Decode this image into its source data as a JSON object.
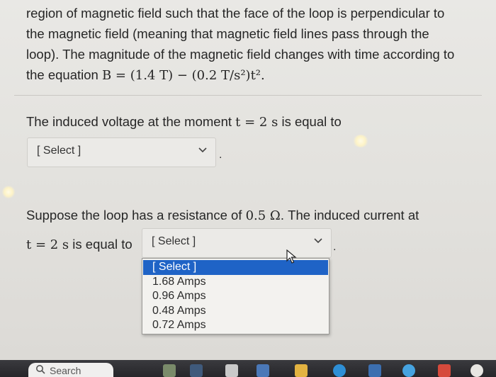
{
  "problem": {
    "line1": "region of magnetic field such that the face of the loop is perpendicular to",
    "line2": "the magnetic field (meaning that magnetic field lines pass through the",
    "line3": "loop). The magnitude of the magnetic field changes with time according to",
    "line4_prefix": "the equation ",
    "equation": "B = (1.4 T) − (0.2 T/s²)t²."
  },
  "question1": {
    "text_prefix": "The induced voltage at the moment ",
    "math": "t = 2 s",
    "text_suffix": " is equal to",
    "select_value": "[ Select ]"
  },
  "question2": {
    "line1_prefix": "Suppose the loop has a resistance of ",
    "line1_math": "0.5 Ω",
    "line1_suffix": ". The induced current at",
    "line2_math": "t = 2 s",
    "line2_suffix": " is equal to",
    "select_value": "[ Select ]",
    "options": [
      "[ Select ]",
      "1.68 Amps",
      "0.96 Amps",
      "0.48 Amps",
      "0.72 Amps"
    ],
    "selected_index": 0
  },
  "taskbar": {
    "search_label": "Search"
  },
  "colors": {
    "highlight": "#1f63c6",
    "taskbar": "#2f2f33"
  }
}
